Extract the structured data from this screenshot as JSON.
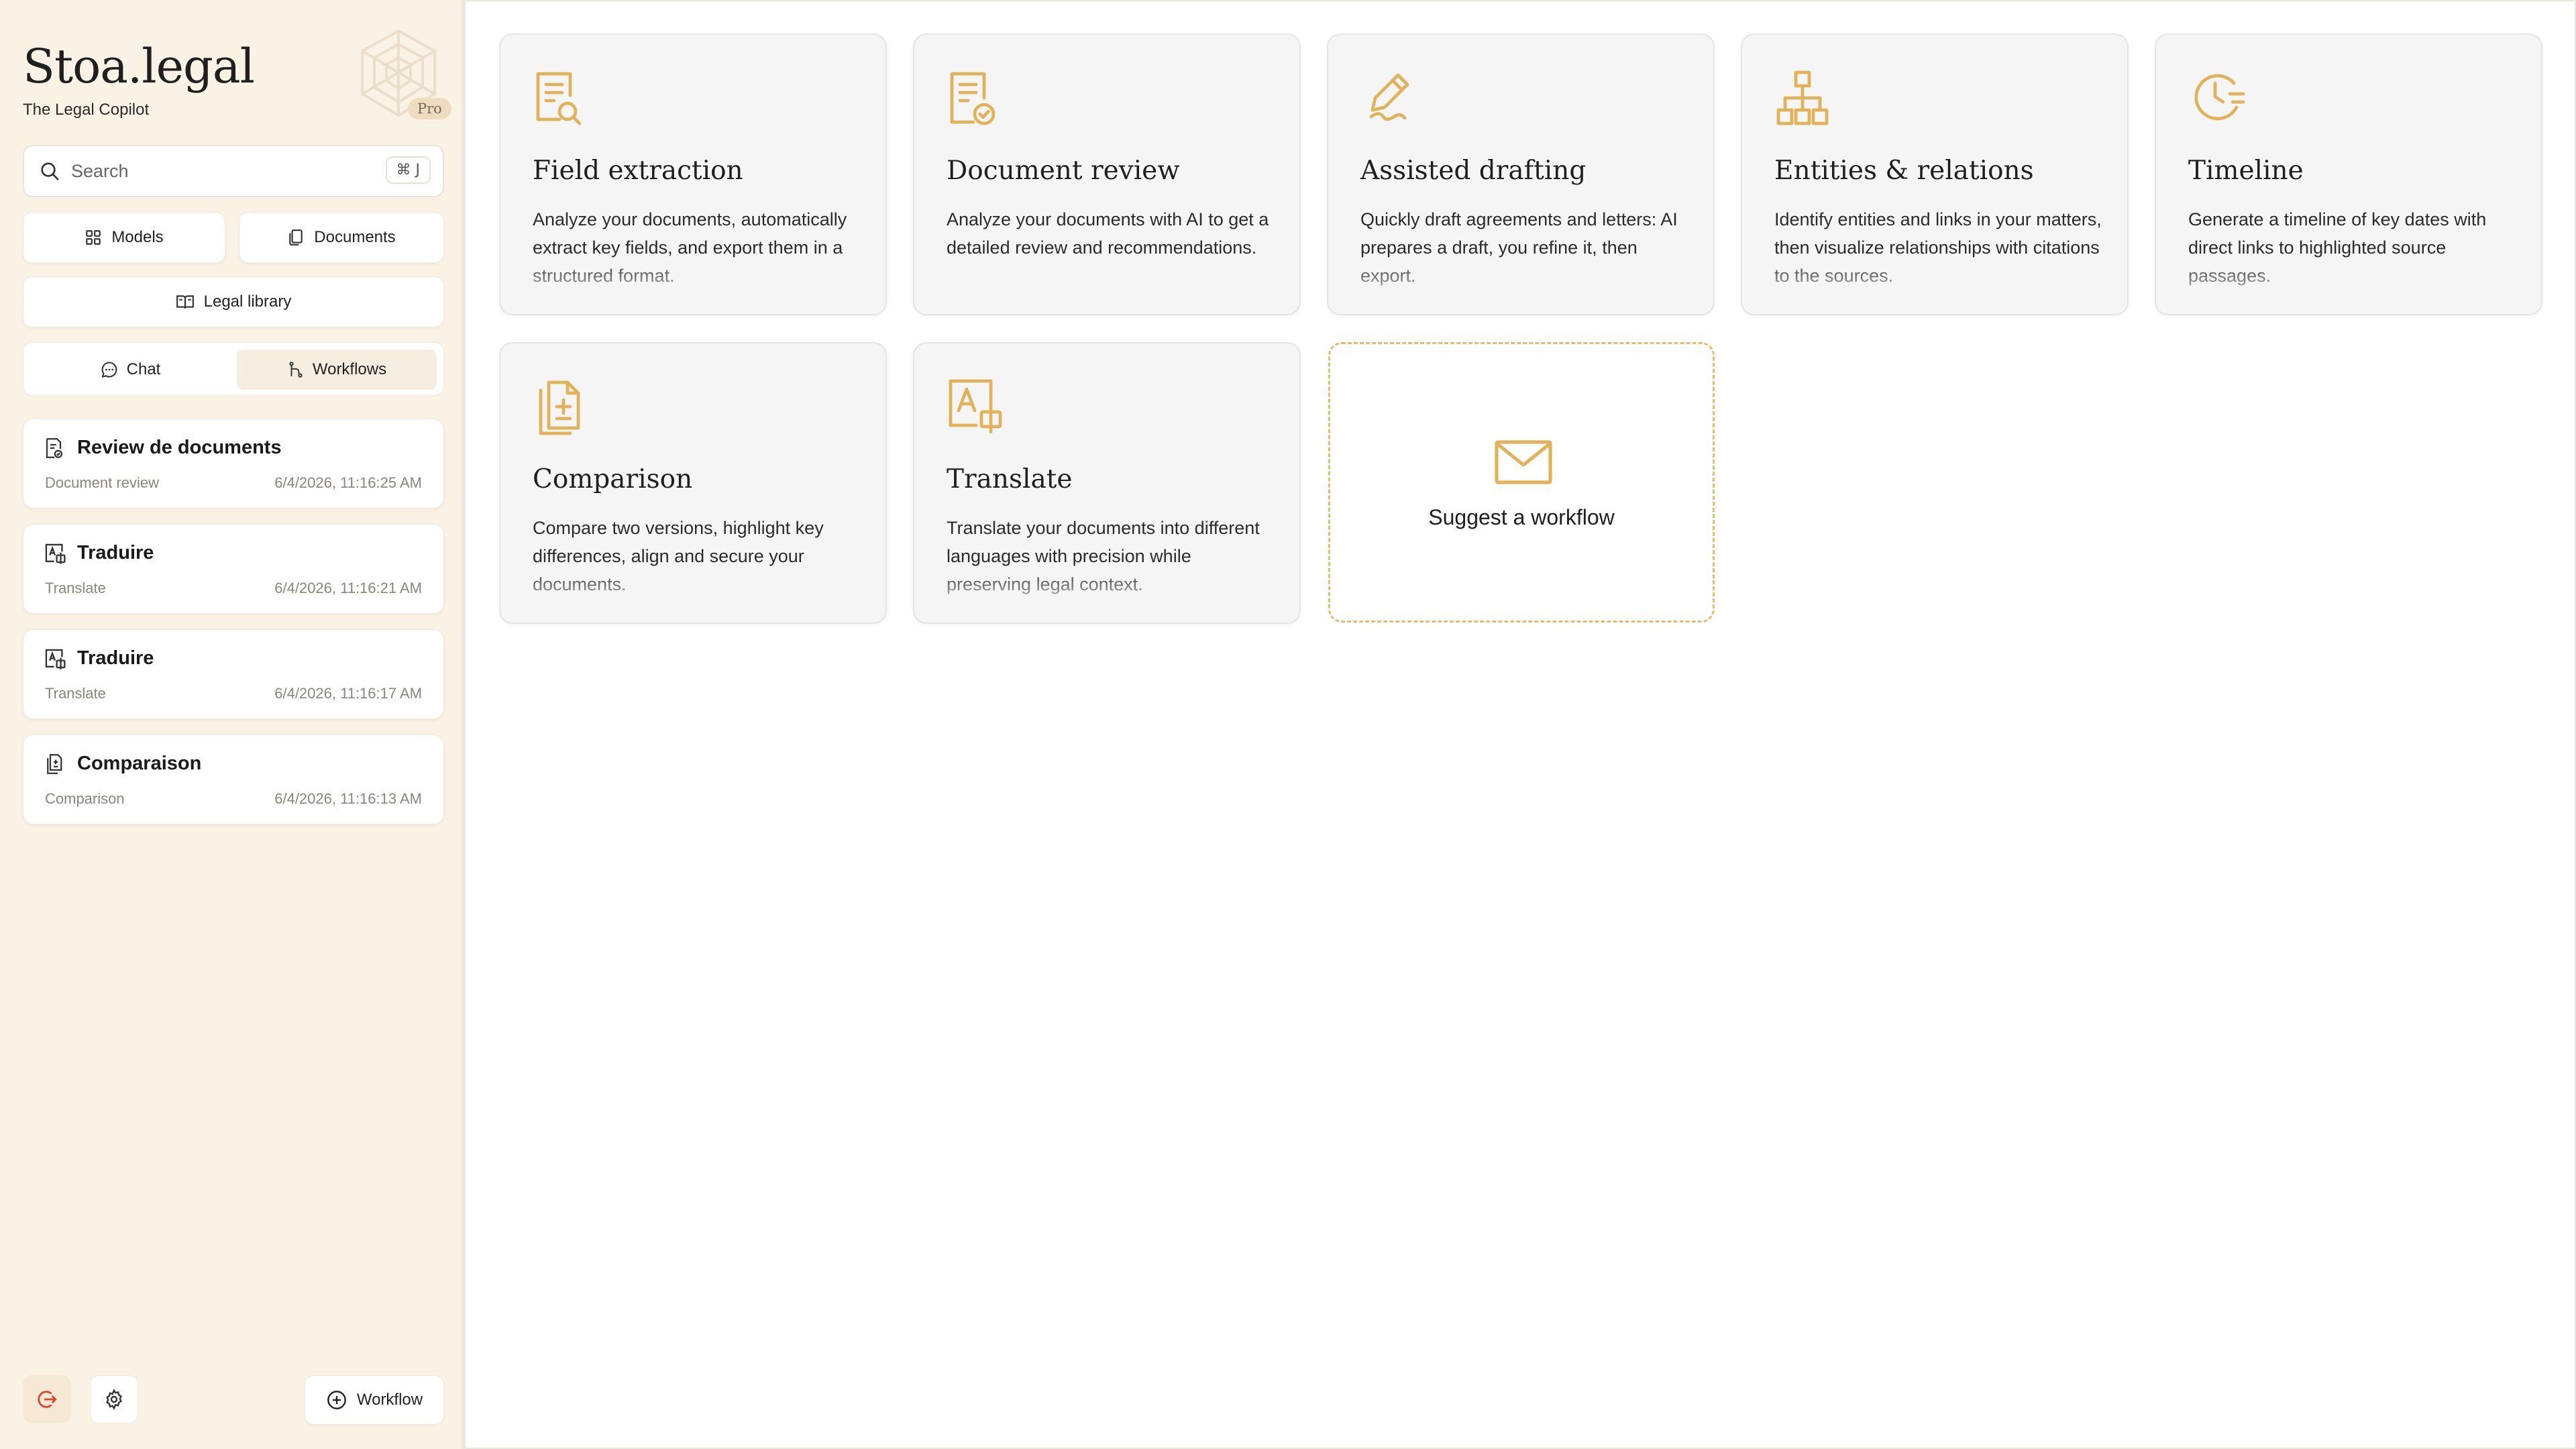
{
  "app": {
    "name": "Stoa.legal",
    "tagline": "The Legal Copilot",
    "badge": "Pro",
    "accent_color": "#e0b35a",
    "sidebar_bg": "#faf2e4"
  },
  "search": {
    "placeholder": "Search",
    "shortcut": "⌘ J"
  },
  "nav": {
    "models": "Models",
    "documents": "Documents",
    "legal_library": "Legal library"
  },
  "tabs": {
    "chat": "Chat",
    "workflows": "Workflows",
    "active": "Workflows"
  },
  "history": [
    {
      "title": "Review de documents",
      "type": "Document review",
      "time": "6/4/2026, 11:16:25 AM",
      "icon": "document-review-icon"
    },
    {
      "title": "Traduire",
      "type": "Translate",
      "time": "6/4/2026, 11:16:21 AM",
      "icon": "translate-icon"
    },
    {
      "title": "Traduire",
      "type": "Translate",
      "time": "6/4/2026, 11:16:17 AM",
      "icon": "translate-icon"
    },
    {
      "title": "Comparaison",
      "type": "Comparison",
      "time": "6/4/2026, 11:16:13 AM",
      "icon": "comparison-icon"
    }
  ],
  "footer": {
    "new_workflow": "Workflow"
  },
  "workflows": [
    {
      "title": "Field extraction",
      "desc": "Analyze your documents, automatically extract key fields, and export them in a structured format.",
      "icon": "field-extraction-icon"
    },
    {
      "title": "Document review",
      "desc": "Analyze your documents with AI to get a detailed review and recommendations.",
      "icon": "document-review-icon"
    },
    {
      "title": "Assisted drafting",
      "desc": "Quickly draft agreements and letters: AI prepares a draft, you refine it, then export.",
      "icon": "pen-icon"
    },
    {
      "title": "Entities & relations",
      "desc": "Identify entities and links in your matters, then visualize relationships with citations to the sources.",
      "icon": "hierarchy-icon"
    },
    {
      "title": "Timeline",
      "desc": "Generate a timeline of key dates with direct links to highlighted source passages.",
      "icon": "timeline-clock-icon"
    },
    {
      "title": "Comparison",
      "desc": "Compare two versions, highlight key differences, align and secure your documents.",
      "icon": "comparison-icon"
    },
    {
      "title": "Translate",
      "desc": "Translate your documents into different languages with precision while preserving legal context.",
      "icon": "translate-icon"
    }
  ],
  "suggest": {
    "label": "Suggest a workflow"
  }
}
